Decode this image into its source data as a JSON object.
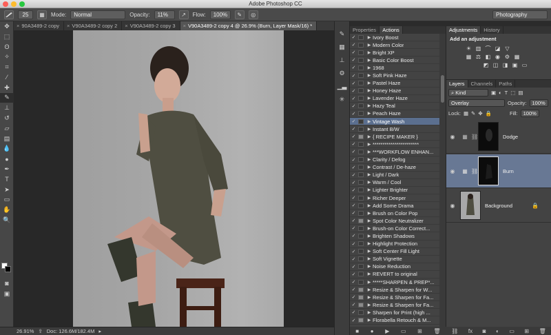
{
  "app_title": "Adobe Photoshop CC",
  "options": {
    "brush_size": "25",
    "mode_label": "Mode:",
    "mode_value": "Normal",
    "opacity_label": "Opacity:",
    "opacity_value": "11%",
    "flow_label": "Flow:",
    "flow_value": "100%",
    "workspace": "Photography"
  },
  "doc_tabs": [
    {
      "label": "90A3489-2 copy"
    },
    {
      "label": "V90A3489-2 copy 2"
    },
    {
      "label": "V90A3489-2 copy 3"
    },
    {
      "label": "V90A3489-2 copy 4 @ 26.9% (Burn, Layer Mask/16) *"
    }
  ],
  "status": {
    "zoom": "26.91%",
    "doc": "Doc: 126.6M/182.4M"
  },
  "actions_panel": {
    "tabs": [
      "Properties",
      "Actions"
    ],
    "items": [
      {
        "check": "✓",
        "dialog": false,
        "name": "Ivory Boost"
      },
      {
        "check": "✓",
        "dialog": false,
        "name": "Modern Color"
      },
      {
        "check": "✓",
        "dialog": false,
        "name": "Bright XP"
      },
      {
        "check": "✓",
        "dialog": false,
        "name": "Basic Color Boost"
      },
      {
        "check": "✓",
        "dialog": false,
        "name": "1968"
      },
      {
        "check": "✓",
        "dialog": false,
        "name": "Soft Pink Haze"
      },
      {
        "check": "✓",
        "dialog": false,
        "name": "Pastel Haze"
      },
      {
        "check": "✓",
        "dialog": false,
        "name": "Honey Haze"
      },
      {
        "check": "✓",
        "dialog": false,
        "name": "Lavender Haze"
      },
      {
        "check": "✓",
        "dialog": false,
        "name": "Hazy Teal"
      },
      {
        "check": "✓",
        "dialog": false,
        "name": "Peach Haze"
      },
      {
        "check": "✓",
        "dialog": false,
        "name": "Vintage Wash",
        "selected": true
      },
      {
        "check": "✓",
        "dialog": false,
        "name": "Instant B/W"
      },
      {
        "check": "✓",
        "dialog": true,
        "name": "{ RECIPE MAKER }"
      },
      {
        "check": "✓",
        "dialog": false,
        "name": "***********************"
      },
      {
        "check": "✓",
        "dialog": false,
        "name": "***WORKFLOW ENHAN..."
      },
      {
        "check": "✓",
        "dialog": false,
        "name": "Clarity / Defog"
      },
      {
        "check": "✓",
        "dialog": false,
        "name": "Contrast / De-haze"
      },
      {
        "check": "✓",
        "dialog": false,
        "name": "Light / Dark"
      },
      {
        "check": "✓",
        "dialog": false,
        "name": "Warm / Cool"
      },
      {
        "check": "✓",
        "dialog": false,
        "name": "Lighter Brighter"
      },
      {
        "check": "✓",
        "dialog": false,
        "name": "Richer Deeper"
      },
      {
        "check": "✓",
        "dialog": false,
        "name": "Add Some Drama"
      },
      {
        "check": "✓",
        "dialog": false,
        "name": "Brush on Color Pop"
      },
      {
        "check": "✓",
        "dialog": true,
        "name": "Spot Color Neutralizer"
      },
      {
        "check": "✓",
        "dialog": false,
        "name": "Brush-on Color Correct..."
      },
      {
        "check": "✓",
        "dialog": false,
        "name": "Brighten Shadows"
      },
      {
        "check": "✓",
        "dialog": false,
        "name": "Highlight Protection"
      },
      {
        "check": "✓",
        "dialog": false,
        "name": "Soft Center Fill Light"
      },
      {
        "check": "✓",
        "dialog": false,
        "name": "Soft Vignette"
      },
      {
        "check": "✓",
        "dialog": false,
        "name": "Noise Reduction"
      },
      {
        "check": "✓",
        "dialog": false,
        "name": "REVERT to original"
      },
      {
        "check": "✓",
        "dialog": false,
        "name": "*****SHARPEN & PREP*..."
      },
      {
        "check": "✓",
        "dialog": true,
        "name": "Resize & Sharpen for W..."
      },
      {
        "check": "✓",
        "dialog": true,
        "name": "Resize & Sharpen for Fa..."
      },
      {
        "check": "✓",
        "dialog": true,
        "name": "Resize & Sharpen for Fa..."
      },
      {
        "check": "✓",
        "dialog": false,
        "name": "Sharpen for Print (high ..."
      },
      {
        "check": "✓",
        "dialog": true,
        "name": "Florabella Retouch & M..."
      }
    ]
  },
  "adjustments": {
    "tabs": [
      "Adjustments",
      "History"
    ],
    "title": "Add an adjustment"
  },
  "layers_panel": {
    "tabs": [
      "Layers",
      "Channels",
      "Paths"
    ],
    "kind": "Kind",
    "blend_mode": "Overlay",
    "opacity_label": "Opacity:",
    "opacity_value": "100%",
    "lock_label": "Lock:",
    "fill_label": "Fill:",
    "fill_value": "100%",
    "layers": [
      {
        "name": "Dodge",
        "selected": false
      },
      {
        "name": "Burn",
        "selected": true
      },
      {
        "name": "Background",
        "selected": false
      }
    ]
  },
  "colors": {
    "selection_blue": "#5b6f8f",
    "layer_selected": "#687894",
    "foreground": "#ffffff",
    "background": "#000000"
  }
}
